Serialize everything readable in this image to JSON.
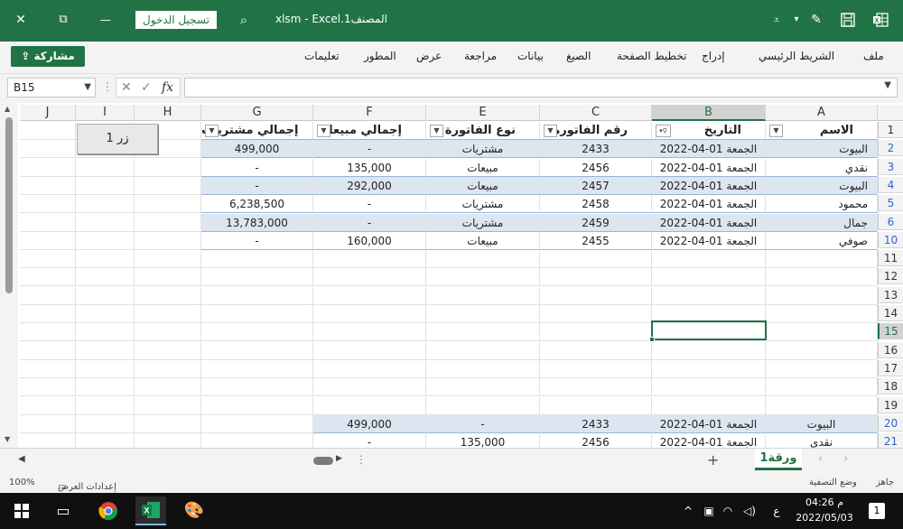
{
  "titlebar": {
    "close": "✕",
    "restore": "⧉",
    "minimize": "—",
    "sign_in": "تسجيل الدخول",
    "title": "المصنف1.xlsm - Excel"
  },
  "ribbon": {
    "share": "مشاركة",
    "tabs": [
      "ملف",
      "الشريط الرئيسي",
      "إدراج",
      "تخطيط الصفحة",
      "الصيغ",
      "بيانات",
      "مراجعة",
      "عرض",
      "المطور",
      "تعليمات"
    ]
  },
  "formula_bar": {
    "name_box": "B15",
    "formula": ""
  },
  "columns": [
    "A",
    "B",
    "C",
    "E",
    "F",
    "G",
    "H",
    "I",
    "J"
  ],
  "rows": [
    "1",
    "2",
    "3",
    "4",
    "5",
    "6",
    "10",
    "11",
    "12",
    "13",
    "14",
    "15",
    "16",
    "17",
    "18",
    "19",
    "20",
    "21"
  ],
  "headers": {
    "name": "الاسم",
    "date": "التاريخ",
    "invoice_no": "رقم الفاتورة",
    "invoice_type": "نوع الفاتورة",
    "total_sales": "إجمالي مبيعات",
    "total_purchases": "إجمالي مشتريات"
  },
  "table_rows": [
    [
      "البيوت",
      "الجمعة 01-04-2022",
      "2433",
      "مشتريات",
      "-",
      "499,000"
    ],
    [
      "نقدي",
      "الجمعة 01-04-2022",
      "2456",
      "مبيعات",
      "135,000",
      "-"
    ],
    [
      "البيوت",
      "الجمعة 01-04-2022",
      "2457",
      "مبيعات",
      "292,000",
      "-"
    ],
    [
      "محمود",
      "الجمعة 01-04-2022",
      "2458",
      "مشتريات",
      "-",
      "6,238,500"
    ],
    [
      "جمال",
      "الجمعة 01-04-2022",
      "2459",
      "مشتريات",
      "-",
      "13,783,000"
    ],
    [
      "صوفي",
      "الجمعة 01-04-2022",
      "2455",
      "مبيعات",
      "160,000",
      "-"
    ]
  ],
  "lower_rows": [
    [
      "البيوت",
      "الجمعة 01-04-2022",
      "2433",
      "-",
      "499,000"
    ],
    [
      "نقدي",
      "الجمعة 01-04-2022",
      "2456",
      "135,000",
      "-"
    ]
  ],
  "form_button": "زر 1",
  "sheet_tab": "ورقة1",
  "status": {
    "ready": "جاهز",
    "filter_mode": "وضع التصفية",
    "display_settings": "إعدادات العرض",
    "zoom": "100%"
  },
  "taskbar": {
    "time": "04:26 م",
    "date": "2022/05/03",
    "lang": "ع",
    "notifications": "1"
  }
}
